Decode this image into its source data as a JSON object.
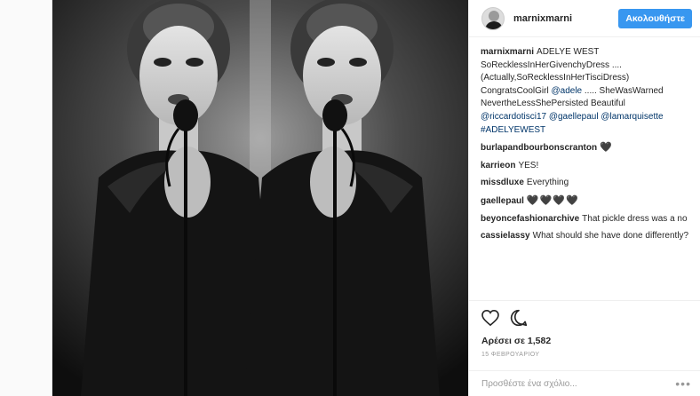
{
  "header": {
    "username": "marnixmarni",
    "follow_label": "Ακολουθήστε"
  },
  "comments": [
    {
      "user": "marnixmarni",
      "parts": [
        {
          "t": "ADELYE WEST SoRecklessInHerGivenchyDress .... (Actually,SoRecklessInHerTisciDress) CongratsCoolGirl "
        },
        {
          "t": "@adele",
          "link": true
        },
        {
          "t": " ..... SheWasWarned NevertheLessShePersisted Beautiful "
        },
        {
          "t": "@riccardotisci17",
          "link": true
        },
        {
          "t": " "
        },
        {
          "t": "@gaellepaul",
          "link": true
        },
        {
          "t": " "
        },
        {
          "t": "@lamarquisette",
          "link": true
        },
        {
          "t": " "
        },
        {
          "t": "#ADELYEWEST",
          "link": true
        }
      ]
    },
    {
      "user": "burlapandbourbonscranton",
      "parts": [
        {
          "t": "🖤",
          "emoji": true
        }
      ]
    },
    {
      "user": "karrieon",
      "parts": [
        {
          "t": "YES!"
        }
      ]
    },
    {
      "user": "missdluxe",
      "parts": [
        {
          "t": "Everything"
        }
      ]
    },
    {
      "user": "gaellepaul",
      "parts": [
        {
          "t": "🖤🖤🖤🖤",
          "emoji": true
        }
      ]
    },
    {
      "user": "beyoncefashionarchive",
      "parts": [
        {
          "t": "That pickle dress was a no"
        }
      ]
    },
    {
      "user": "cassielassy",
      "parts": [
        {
          "t": "What should she have done differently?"
        }
      ]
    }
  ],
  "actions": {
    "likes": "Αρέσει σε 1,582",
    "date": "15 ΦΕΒΡΟΥΑΡΙΟΥ"
  },
  "add_comment": {
    "placeholder": "Προσθέστε ένα σχόλιο...",
    "more": "•••"
  },
  "colors": {
    "accent": "#3897f0",
    "link": "#003569",
    "muted": "#999999"
  },
  "icons": [
    "heart-icon",
    "comment-icon",
    "more-options-icon"
  ]
}
